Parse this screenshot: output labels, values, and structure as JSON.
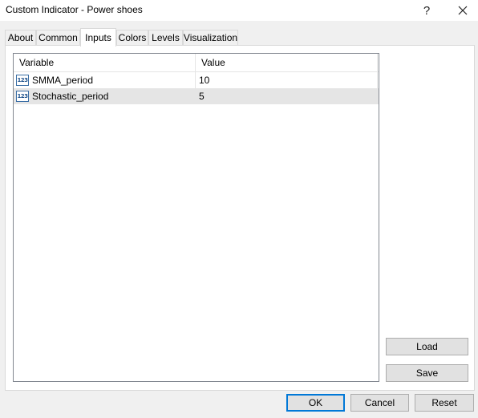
{
  "window": {
    "title": "Custom Indicator - Power shoes",
    "help_glyph": "?",
    "close_icon": "close-icon"
  },
  "tabs": [
    {
      "label": "About"
    },
    {
      "label": "Common"
    },
    {
      "label": "Inputs",
      "active": true
    },
    {
      "label": "Colors"
    },
    {
      "label": "Levels"
    },
    {
      "label": "Visualization"
    }
  ],
  "inputs_table": {
    "columns": [
      "Variable",
      "Value"
    ],
    "rows": [
      {
        "icon": "numeric-type-icon",
        "icon_text": "123",
        "variable": "SMMA_period",
        "value": "10"
      },
      {
        "icon": "numeric-type-icon",
        "icon_text": "123",
        "variable": "Stochastic_period",
        "value": "5",
        "selected": true
      }
    ]
  },
  "side_buttons": {
    "load": "Load",
    "save": "Save"
  },
  "footer_buttons": {
    "ok": "OK",
    "cancel": "Cancel",
    "reset": "Reset"
  },
  "colors": {
    "dialog_bg": "#f0f0f0",
    "selected_row": "#e5e5e5",
    "default_button_border": "#0078d7"
  }
}
